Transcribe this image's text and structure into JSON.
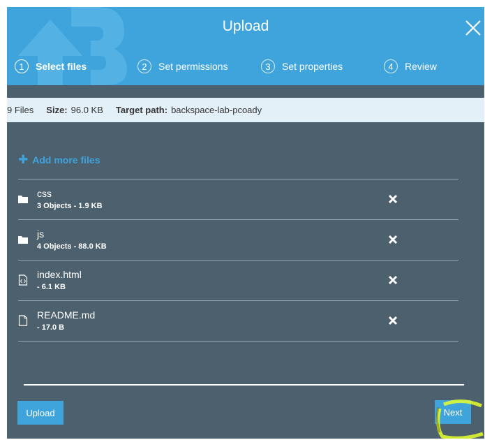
{
  "dialog": {
    "title": "Upload",
    "steps": [
      {
        "number": "1",
        "label": "Select files",
        "active": true
      },
      {
        "number": "2",
        "label": "Set permissions",
        "active": false
      },
      {
        "number": "3",
        "label": "Set properties",
        "active": false
      },
      {
        "number": "4",
        "label": "Review",
        "active": false
      }
    ]
  },
  "summary": {
    "files_count": "9 Files",
    "size_label": "Size:",
    "size_value": "96.0 KB",
    "target_label": "Target path:",
    "target_value": "backspace-lab-pcoady"
  },
  "add_more_label": "Add more files",
  "files": [
    {
      "name": "css",
      "meta": "3 Objects - 1.9 KB",
      "icon": "folder-icon"
    },
    {
      "name": "js",
      "meta": "4 Objects - 88.0 KB",
      "icon": "folder-icon"
    },
    {
      "name": "index.html",
      "meta": "- 6.1 KB",
      "icon": "code-file-icon"
    },
    {
      "name": "README.md",
      "meta": "- 17.0 B",
      "icon": "file-icon"
    }
  ],
  "buttons": {
    "upload": "Upload",
    "next": "Next"
  },
  "colors": {
    "header": "#3fa3dc",
    "body": "#4c606d",
    "summary": "#e4f0f8",
    "accent": "#3fa3dc",
    "highlight": "#e8ff2a"
  }
}
